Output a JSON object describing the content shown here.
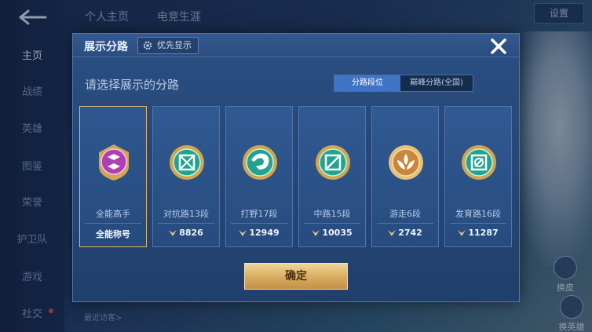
{
  "background": {
    "nav_items": [
      {
        "label": "主页",
        "active": true
      },
      {
        "label": "战绩",
        "active": false
      },
      {
        "label": "英雄",
        "active": false
      },
      {
        "label": "图鉴",
        "active": false
      },
      {
        "label": "荣誉",
        "active": false
      },
      {
        "label": "护卫队",
        "active": false
      },
      {
        "label": "游戏",
        "active": false
      },
      {
        "label": "社交",
        "active": false
      }
    ],
    "top_tabs": [
      "个人主页",
      "电竞生涯"
    ],
    "settings_label": "设置",
    "right_actions": [
      "换皮",
      "换英雄"
    ],
    "recent_visitors_label": "最近访客>"
  },
  "modal": {
    "title": "展示分路",
    "priority_label": "优先显示",
    "subtitle": "请选择展示的分路",
    "toggle": {
      "options": [
        "分路段位",
        "巅峰分路(全国)"
      ],
      "active": "分路段位"
    },
    "cards": [
      {
        "name": "全能高手",
        "footer": "全能称号",
        "score": null,
        "selected": true,
        "emblem": "all-round-emblem-icon",
        "color": "#b03fb0"
      },
      {
        "name": "对抗路13段",
        "footer": null,
        "score": "8826",
        "selected": false,
        "emblem": "clash-lane-emblem-icon",
        "color": "#23a38f"
      },
      {
        "name": "打野17段",
        "footer": null,
        "score": "12949",
        "selected": false,
        "emblem": "jungle-emblem-icon",
        "color": "#23a38f"
      },
      {
        "name": "中路15段",
        "footer": null,
        "score": "10035",
        "selected": false,
        "emblem": "mid-lane-emblem-icon",
        "color": "#23a38f"
      },
      {
        "name": "游走6段",
        "footer": null,
        "score": "2742",
        "selected": false,
        "emblem": "roam-emblem-icon",
        "color": "#c8873a"
      },
      {
        "name": "发育路16段",
        "footer": null,
        "score": "11287",
        "selected": false,
        "emblem": "farm-lane-emblem-icon",
        "color": "#23a38f"
      }
    ],
    "confirm_label": "确定"
  }
}
